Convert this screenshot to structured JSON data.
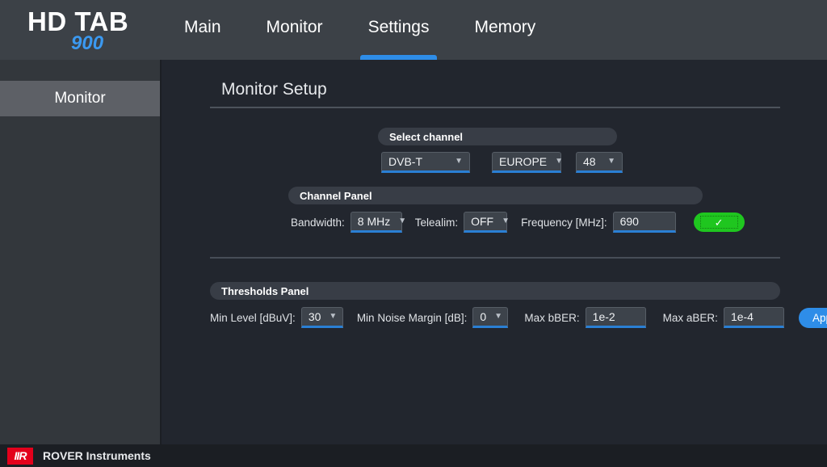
{
  "brand": {
    "name": "HD TAB",
    "model": "900"
  },
  "nav": {
    "items": [
      {
        "label": "Main",
        "active": false
      },
      {
        "label": "Monitor",
        "active": false
      },
      {
        "label": "Settings",
        "active": true
      },
      {
        "label": "Memory",
        "active": false
      }
    ]
  },
  "sidebar": {
    "items": [
      {
        "label": "Monitor",
        "active": true
      }
    ]
  },
  "main": {
    "page_title": "Monitor Setup",
    "select_channel": {
      "header": "Select channel",
      "standard": {
        "value": "DVB-T",
        "caret": "chevron-down-icon"
      },
      "region": {
        "value": "EUROPE",
        "caret": "chevron-down-icon"
      },
      "channel": {
        "value": "48",
        "caret": "chevron-down-icon"
      }
    },
    "channel_panel": {
      "header": "Channel Panel",
      "bandwidth_label": "Bandwidth:",
      "bandwidth_value": "8 MHz",
      "telealim_label": "Telealim:",
      "telealim_value": "OFF",
      "frequency_label": "Frequency [MHz]:",
      "frequency_value": "690",
      "frequency_placeholder": "690",
      "confirm_icon": "check-icon",
      "confirm_glyph": "✓"
    },
    "thresholds_panel": {
      "header": "Thresholds Panel",
      "min_level_label": "Min Level [dBuV]:",
      "min_level_value": "30",
      "min_noise_label": "Min Noise Margin [dB]:",
      "min_noise_value": "0",
      "max_bber_label": "Max bBER:",
      "max_bber_value": "1e-2",
      "max_bber_placeholder": "1e-2",
      "max_aber_label": "Max aBER:",
      "max_aber_value": "1e-4",
      "max_aber_placeholder": "1e-4",
      "apply_label": "Apply"
    }
  },
  "footer": {
    "logo_text": "IIR",
    "logo_icon": "rover-logo-icon",
    "company": "ROVER Instruments"
  },
  "colors": {
    "accent_blue": "#2e8de8",
    "brand_blue": "#3b99f0",
    "confirm_green": "#1fc61f",
    "logo_red": "#e3001b",
    "header_bg": "#3c4147",
    "sidebar_bg": "#33373c",
    "main_bg": "#22262e",
    "panel_bar_bg": "#383d46",
    "control_bg": "#3d434b"
  }
}
